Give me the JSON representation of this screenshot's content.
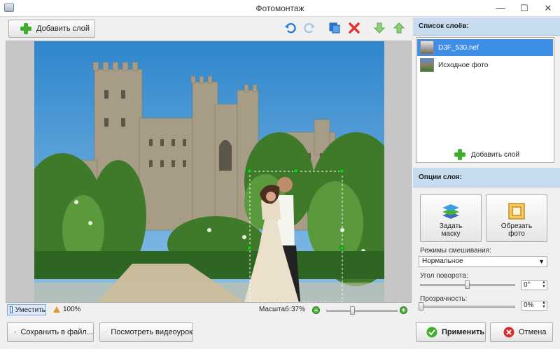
{
  "window": {
    "title": "Фотомонтаж"
  },
  "toolbar": {
    "add_layer_label": "Добавить слой"
  },
  "status": {
    "fit_label": "Уместить",
    "zoom_100_label": "100%",
    "scale_label": "Масштаб:",
    "scale_value": "37%",
    "scale_level": 0.37
  },
  "bottom": {
    "save_label": "Сохранить в файл...",
    "video_label": "Посмотреть видеоурок",
    "apply_label": "Применить",
    "cancel_label": "Отмена"
  },
  "layers_panel": {
    "header": "Список слоёв:",
    "items": [
      {
        "label": "D3F_530.nef",
        "selected": true
      },
      {
        "label": "Исходное фото",
        "selected": false
      }
    ],
    "add_label": "Добавить слой"
  },
  "options_panel": {
    "header": "Опции слоя:",
    "mask_label_line1": "Задать",
    "mask_label_line2": "маску",
    "crop_label_line1": "Обрезать",
    "crop_label_line2": "фото",
    "blend_label": "Режимы смешивания:",
    "blend_value": "Нормальное",
    "rotation_label": "Угол поворота:",
    "rotation_value": "0°",
    "opacity_label": "Прозрачность:",
    "opacity_value": "0%"
  },
  "colors": {
    "accent": "#3d8ee6",
    "header_bg": "#c8dcf0",
    "green": "#3fae2a",
    "red": "#e03030"
  }
}
